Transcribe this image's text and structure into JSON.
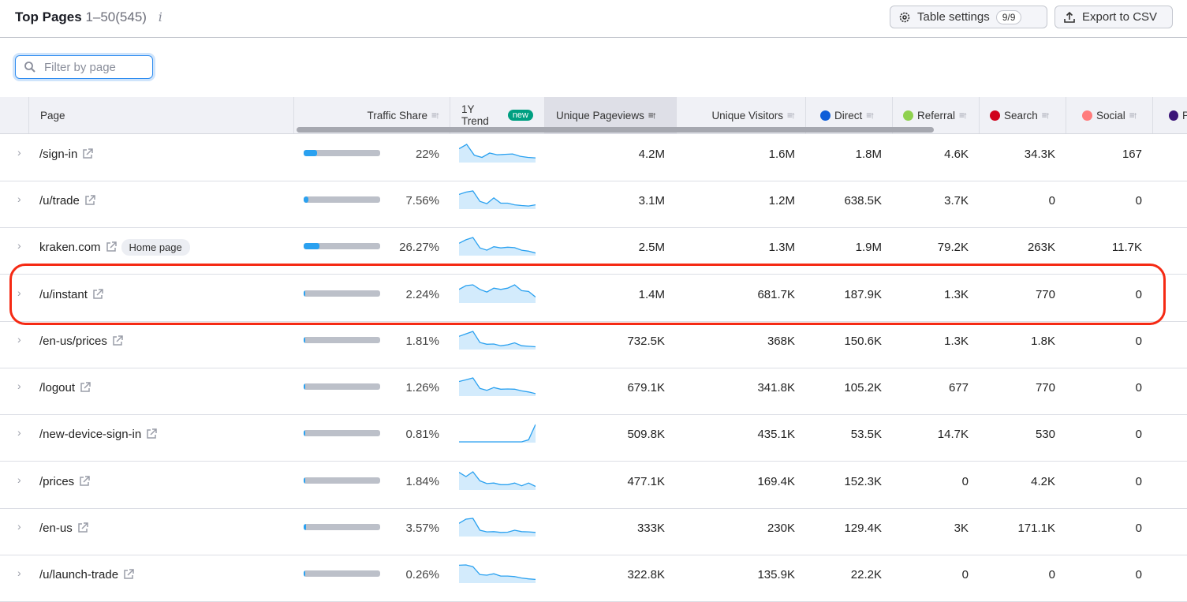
{
  "header": {
    "title": "Top Pages",
    "range": "1–50(545)",
    "info_icon": "i",
    "table_settings_label": "Table settings",
    "table_settings_count": "9/9",
    "export_label": "Export to CSV"
  },
  "filter": {
    "placeholder": "Filter by page",
    "value": ""
  },
  "columns": {
    "page": "Page",
    "traffic_share": "Traffic Share",
    "trend": "1Y Trend",
    "trend_badge": "new",
    "unique_pageviews": "Unique Pageviews",
    "unique_visitors": "Unique Visitors",
    "direct": "Direct",
    "referral": "Referral",
    "search": "Search",
    "social": "Social",
    "paid": "P"
  },
  "colors": {
    "direct": "#0f5ed8",
    "referral": "#8fd14f",
    "search": "#d0021b",
    "social": "#ff7c7c",
    "paid": "#3b1578",
    "accent": "#2aa1f0",
    "highlight": "#f52a14"
  },
  "rows": [
    {
      "page": "/sign-in",
      "badge": "",
      "share": "22%",
      "share_value": 22,
      "trend": [
        6,
        8,
        3,
        2,
        4,
        3.2,
        3.4,
        3.6,
        2.5,
        2,
        1.8
      ],
      "upv": "4.2M",
      "uv": "1.6M",
      "direct": "1.8M",
      "referral": "4.6K",
      "search": "34.3K",
      "social": "167"
    },
    {
      "page": "/u/trade",
      "badge": "",
      "share": "7.56%",
      "share_value": 7.56,
      "trend": [
        6,
        7,
        7.5,
        3,
        2,
        4.5,
        2.2,
        2.2,
        1.5,
        1.2,
        1,
        1.5
      ],
      "upv": "3.1M",
      "uv": "1.2M",
      "direct": "638.5K",
      "referral": "3.7K",
      "search": "0",
      "social": "0"
    },
    {
      "page": "kraken.com",
      "badge": "Home page",
      "share": "26.27%",
      "share_value": 26.27,
      "trend": [
        5,
        6.5,
        7.5,
        3,
        2,
        3.5,
        3,
        3.3,
        3.1,
        2,
        1.6,
        0.8
      ],
      "upv": "2.5M",
      "uv": "1.3M",
      "direct": "1.9M",
      "referral": "79.2K",
      "search": "263K",
      "social": "11.7K"
    },
    {
      "page": "/u/instant",
      "badge": "",
      "share": "2.24%",
      "share_value": 2.24,
      "trend": [
        5,
        6.5,
        6.8,
        5,
        4,
        5.5,
        5,
        5.5,
        6.8,
        4.5,
        4.2,
        2
      ],
      "upv": "1.4M",
      "uv": "681.7K",
      "direct": "187.9K",
      "referral": "1.3K",
      "search": "770",
      "social": "0"
    },
    {
      "page": "/en-us/prices",
      "badge": "",
      "share": "1.81%",
      "share_value": 1.81,
      "trend": [
        5,
        6,
        7,
        2.5,
        1.8,
        1.9,
        1.2,
        1.6,
        2.4,
        1.2,
        1,
        0.8
      ],
      "upv": "732.5K",
      "uv": "368K",
      "direct": "150.6K",
      "referral": "1.3K",
      "search": "1.8K",
      "social": "0"
    },
    {
      "page": "/logout",
      "badge": "",
      "share": "1.26%",
      "share_value": 1.26,
      "trend": [
        5,
        5.6,
        6.3,
        2.5,
        1.8,
        2.8,
        2.2,
        2.3,
        2.2,
        1.6,
        1.2,
        0.6
      ],
      "upv": "679.1K",
      "uv": "341.8K",
      "direct": "105.2K",
      "referral": "677",
      "search": "770",
      "social": "0"
    },
    {
      "page": "/new-device-sign-in",
      "badge": "",
      "share": "0.81%",
      "share_value": 0.81,
      "trend": [
        0,
        0,
        0,
        0,
        0,
        0,
        0,
        0,
        0,
        0,
        0.6,
        5
      ],
      "upv": "509.8K",
      "uv": "435.1K",
      "direct": "53.5K",
      "referral": "14.7K",
      "search": "530",
      "social": "0"
    },
    {
      "page": "/prices",
      "badge": "",
      "share": "1.84%",
      "share_value": 1.84,
      "trend": [
        6,
        4.5,
        6.2,
        3,
        2,
        2.2,
        1.6,
        1.6,
        2.2,
        1.2,
        2.2,
        1
      ],
      "upv": "477.1K",
      "uv": "169.4K",
      "direct": "152.3K",
      "referral": "0",
      "search": "4.2K",
      "social": "0"
    },
    {
      "page": "/en-us",
      "badge": "",
      "share": "3.57%",
      "share_value": 3.57,
      "trend": [
        4.5,
        6,
        6.3,
        2,
        1.4,
        1.5,
        1.2,
        1.3,
        2,
        1.5,
        1.4,
        1.2
      ],
      "upv": "333K",
      "uv": "230K",
      "direct": "129.4K",
      "referral": "3K",
      "search": "171.1K",
      "social": "0"
    },
    {
      "page": "/u/launch-trade",
      "badge": "",
      "share": "0.26%",
      "share_value": 0.26,
      "trend": [
        6,
        6.1,
        5.5,
        2.7,
        2.5,
        3,
        2.2,
        2.2,
        2,
        1.5,
        1.2,
        1
      ],
      "upv": "322.8K",
      "uv": "135.9K",
      "direct": "22.2K",
      "referral": "0",
      "search": "0",
      "social": "0"
    }
  ]
}
